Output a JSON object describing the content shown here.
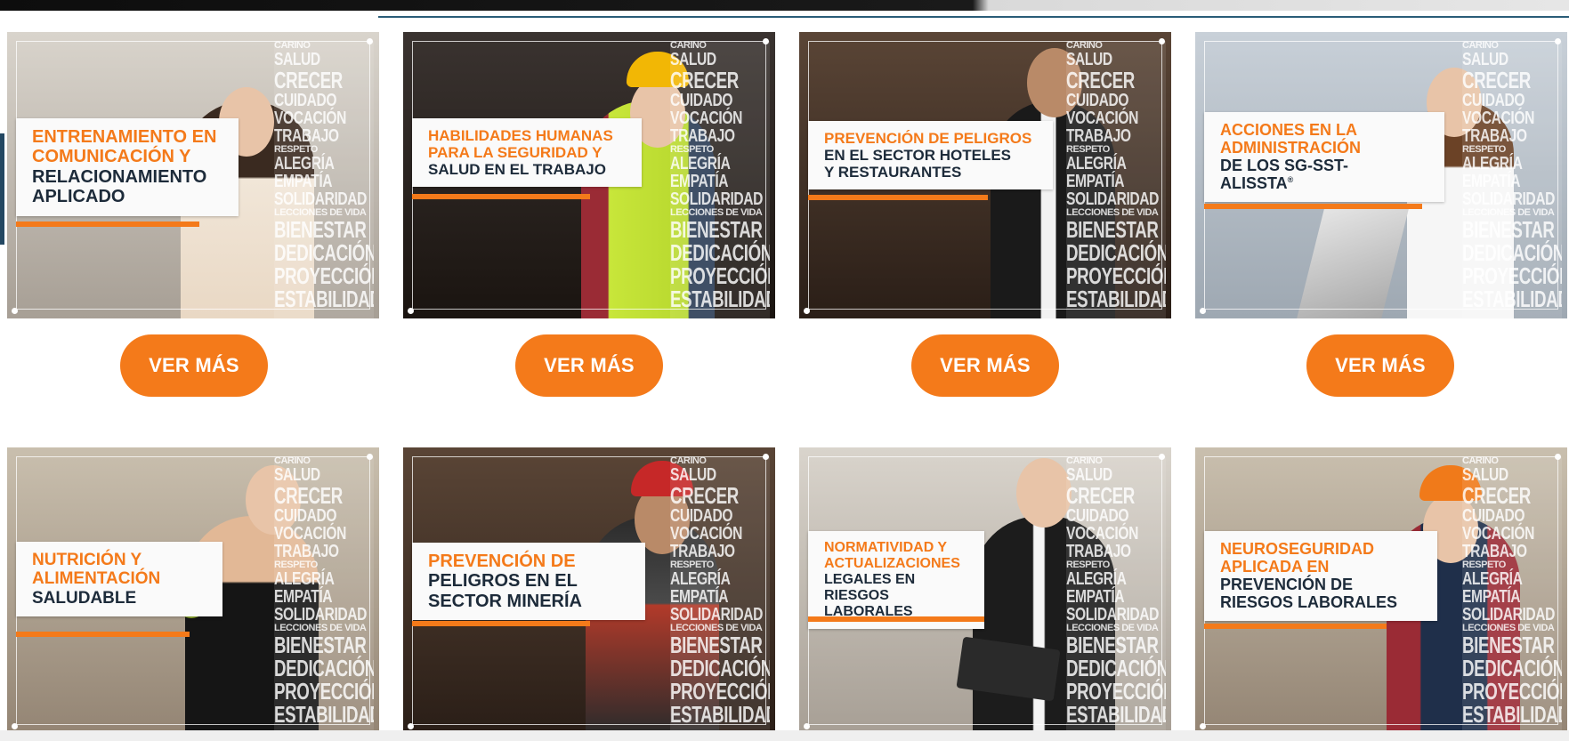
{
  "word_cloud": [
    "CARIÑO",
    "SALUD",
    "CRECER",
    "CUIDADO",
    "VOCACIÓN",
    "TRABAJO",
    "RESPETO",
    "ALEGRÍA",
    "EMPATÍA",
    "SOLIDARIDAD",
    "LECCIONES DE VIDA",
    "BIENESTAR",
    "DEDICACIÓN",
    "PROYECCIÓN",
    "ESTABILIDAD"
  ],
  "cards": [
    {
      "orange": [
        "ENTRENAMIENTO EN",
        "COMUNICACIÓN Y"
      ],
      "dark": [
        "RELACIONAMIENTO",
        "APLICADO"
      ],
      "button": "VER MÁS"
    },
    {
      "orange": [
        "HABILIDADES HUMANAS",
        "PARA LA SEGURIDAD Y"
      ],
      "dark": [
        "SALUD EN EL TRABAJO"
      ],
      "button": "VER MÁS"
    },
    {
      "orange": [
        "PREVENCIÓN DE PELIGROS"
      ],
      "dark": [
        "EN EL SECTOR HOTELES",
        "Y RESTAURANTES"
      ],
      "button": "VER MÁS"
    },
    {
      "orange": [
        "ACCIONES EN LA",
        "ADMINISTRACIÓN"
      ],
      "dark": [
        "DE LOS SG-SST-",
        "ALISSTA"
      ],
      "trademark": "®",
      "button": "VER MÁS"
    },
    {
      "orange": [
        "NUTRICIÓN Y",
        "ALIMENTACIÓN"
      ],
      "dark": [
        "SALUDABLE"
      ]
    },
    {
      "orange": [
        "PREVENCIÓN DE"
      ],
      "dark": [
        "PELIGROS EN EL",
        "SECTOR MINERÍA"
      ]
    },
    {
      "orange": [
        "NORMATIVIDAD Y",
        "ACTUALIZACIONES"
      ],
      "dark": [
        "LEGALES EN",
        "RIESGOS LABORALES"
      ]
    },
    {
      "orange": [
        "NEUROSEGURIDAD",
        "APLICADA EN"
      ],
      "dark": [
        "PREVENCIÓN DE",
        "RIESGOS LABORALES"
      ]
    }
  ],
  "colors": {
    "accent": "#f47a1a",
    "navy": "#1d2b3a",
    "white": "#ffffff"
  }
}
